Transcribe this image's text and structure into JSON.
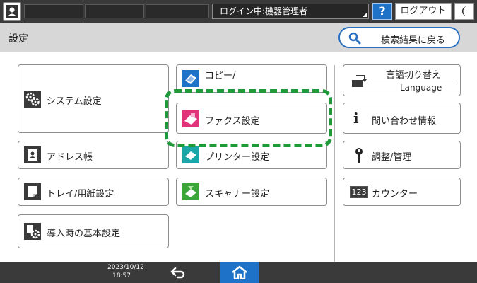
{
  "topbar": {
    "login_status": "ログイン中:機器管理者",
    "help_label": "?",
    "logout_label": "ログアウト"
  },
  "titlebar": {
    "title": "設定",
    "back_to_search": "検索結果に戻る"
  },
  "tiles": {
    "system": "システム設定",
    "copy": "コピー/",
    "fax": "ファクス設定",
    "address": "アドレス帳",
    "printer": "プリンター設定",
    "tray": "トレイ/用紙設定",
    "scanner": "スキャナー設定",
    "initial": "導入時の基本設定",
    "lang_top": "言語切り替え",
    "lang_bottom": "Language",
    "inquiry": "問い合わせ情報",
    "maintenance": "調整/管理",
    "counter": "カウンター",
    "counter_badge": "123"
  },
  "bottombar": {
    "date": "2023/10/12",
    "time": "18:57"
  },
  "colors": {
    "accent": "#1e73c8",
    "highlight": "#1f9a3a",
    "fax_icon": "#e0337a",
    "scanner_icon": "#3aa63a"
  },
  "icons": [
    "user-icon",
    "moon-icon",
    "search-icon",
    "system-gear-icon",
    "copy-icon",
    "fax-icon",
    "address-book-icon",
    "printer-icon",
    "tray-icon",
    "scanner-icon",
    "initial-setup-icon",
    "language-icon",
    "info-icon",
    "wrench-icon",
    "counter-icon",
    "back-arrow-icon",
    "home-icon"
  ]
}
